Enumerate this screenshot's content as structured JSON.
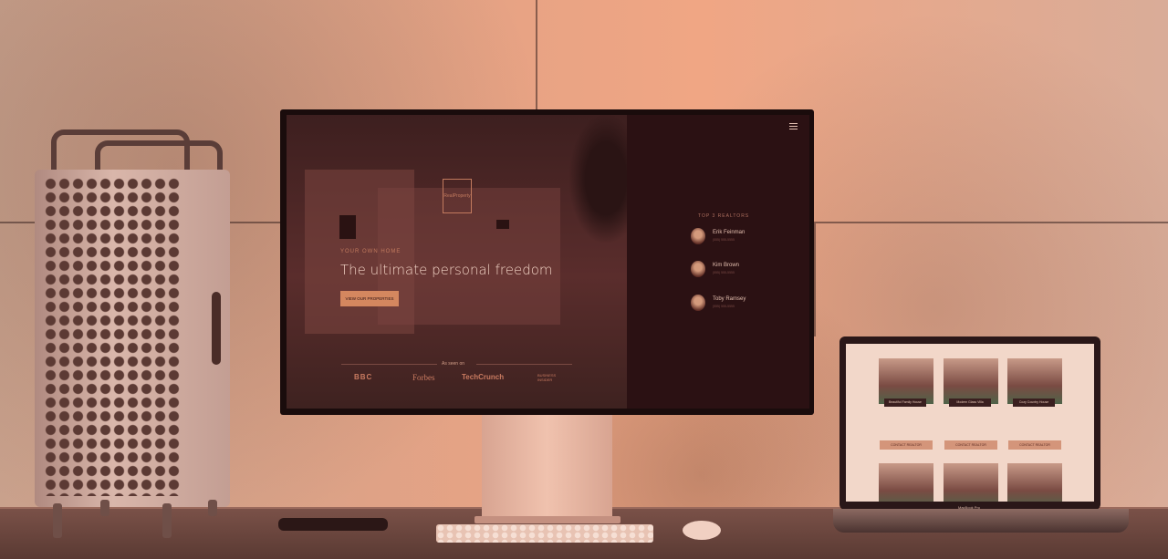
{
  "site": {
    "logo_text": "RealProperty",
    "hero": {
      "kicker": "YOUR OWN HOME",
      "title": "The ultimate personal freedom",
      "button_label": "VIEW OUR PROPERTIES"
    },
    "press": {
      "label": "As seen on",
      "brands": [
        "BBC",
        "Forbes",
        "TechCrunch",
        "BUSINESS INSIDER"
      ]
    },
    "realtors": {
      "title": "TOP 3 REALTORS",
      "items": [
        {
          "name": "Erik Feinman",
          "sub": "(555) 555-5555"
        },
        {
          "name": "Kim Brown",
          "sub": "(555) 555-5555"
        },
        {
          "name": "Toby Ramsey",
          "sub": "(555) 555-5555"
        }
      ]
    }
  },
  "laptop_site": {
    "brand": "MacBook Pro",
    "cards": [
      {
        "caption": "Beautiful Family House",
        "button": "CONTACT REALTOR"
      },
      {
        "caption": "Modern Glass Villa",
        "button": "CONTACT REALTOR"
      },
      {
        "caption": "Cozy Country House",
        "button": "CONTACT REALTOR"
      }
    ]
  },
  "colors": {
    "accent": "#d4875f",
    "screen_bg": "#2b1113",
    "wall_tint": "#e8a384"
  }
}
